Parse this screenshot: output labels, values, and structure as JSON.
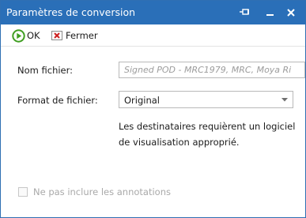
{
  "window": {
    "title": "Paramètres de conversion",
    "controls": [
      "pin-icon",
      "minimize-icon",
      "close-icon"
    ]
  },
  "toolbar": {
    "ok_label": "OK",
    "cancel_label": "Fermer",
    "ok_icon": "play-circle-icon",
    "cancel_icon": "close-x-icon"
  },
  "form": {
    "file_name_label": "Nom fichier:",
    "file_name_value": "Signed POD - MRC1979, MRC, Moya Ri",
    "format_label": "Format de fichier:",
    "format_value": "Original",
    "hint_line1": "Les destinataires requièrent un logiciel",
    "hint_line2": "de visualisation approprié.",
    "exclude_annotations_label": "Ne pas inclure les annotations",
    "exclude_annotations_checked": false
  },
  "colors": {
    "titlebar": "#2a6fb8",
    "ok_green": "#3f9e21",
    "cancel_red": "#cc1f1f"
  }
}
